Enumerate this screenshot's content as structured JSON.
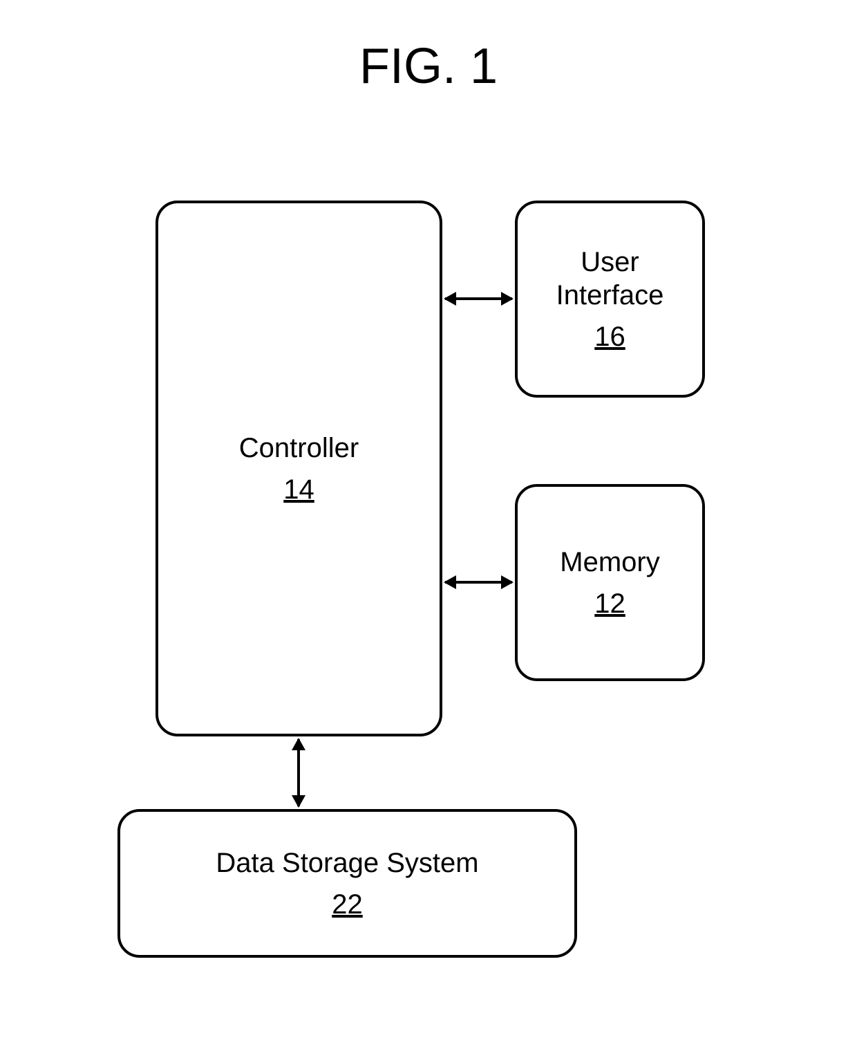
{
  "figure_title": "FIG. 1",
  "blocks": {
    "controller": {
      "label": "Controller",
      "ref": "14"
    },
    "user_interface": {
      "label_line1": "User",
      "label_line2": "Interface",
      "ref": "16"
    },
    "memory": {
      "label": "Memory",
      "ref": "12"
    },
    "data_storage": {
      "label": "Data Storage System",
      "ref": "22"
    }
  },
  "connections": [
    {
      "from": "controller",
      "to": "user_interface",
      "bidirectional": true
    },
    {
      "from": "controller",
      "to": "memory",
      "bidirectional": true
    },
    {
      "from": "controller",
      "to": "data_storage",
      "bidirectional": true
    }
  ]
}
